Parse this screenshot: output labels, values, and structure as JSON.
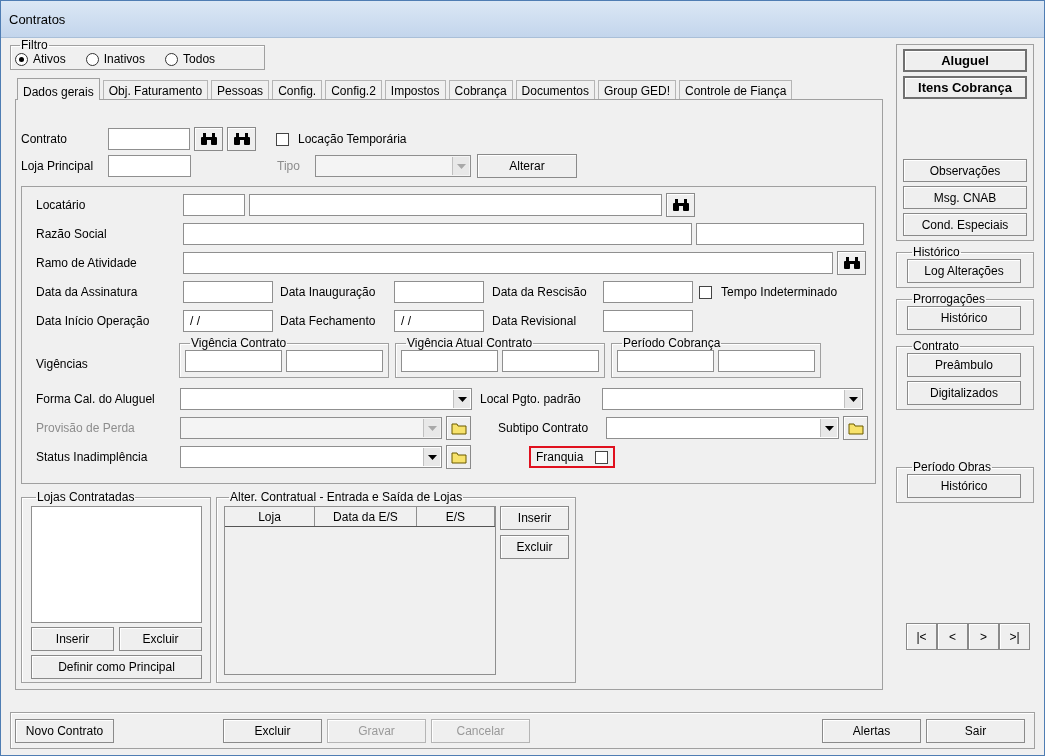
{
  "window": {
    "title": "Contratos"
  },
  "filter": {
    "legend": "Filtro",
    "options": [
      {
        "label": "Ativos",
        "selected": true
      },
      {
        "label": "Inativos",
        "selected": false
      },
      {
        "label": "Todos",
        "selected": false
      }
    ]
  },
  "tabs": [
    {
      "label": "Dados gerais",
      "selected": true
    },
    {
      "label": "Obj. Faturamento",
      "selected": false
    },
    {
      "label": "Pessoas",
      "selected": false
    },
    {
      "label": "Config.",
      "selected": false
    },
    {
      "label": "Config.2",
      "selected": false
    },
    {
      "label": "Impostos",
      "selected": false
    },
    {
      "label": "Cobrança",
      "selected": false
    },
    {
      "label": "Documentos",
      "selected": false
    },
    {
      "label": "Group GED!",
      "selected": false
    },
    {
      "label": "Controle de Fiança",
      "selected": false
    }
  ],
  "header": {
    "contrato_label": "Contrato",
    "locacao_temporaria": {
      "label": "Locação Temporária",
      "checked": false
    },
    "loja_principal_label": "Loja Principal",
    "tipo": {
      "label": "Tipo",
      "disabled": true
    },
    "alterar_button": "Alterar"
  },
  "details": {
    "locatario_label": "Locatário",
    "razao_social_label": "Razão Social",
    "ramo_label": "Ramo de Atividade",
    "data_assinatura_label": "Data da Assinatura",
    "data_inauguracao_label": "Data Inauguração",
    "data_rescisao_label": "Data da Rescisão",
    "tempo_indeterminado": {
      "label": "Tempo Indeterminado",
      "checked": false
    },
    "data_inicio_label": "Data Início Operação",
    "data_inicio_value": "/ /",
    "data_fechamento_label": "Data Fechamento",
    "data_fechamento_value": "/ /",
    "data_revisional_label": "Data Revisional",
    "vigencias_label": "Vigências",
    "vigencia_groups": [
      "Vigência Contrato",
      "Vigência Atual Contrato",
      "Período Cobrança"
    ],
    "forma_calculo_label": "Forma Cal. do Aluguel",
    "local_pgto_label": "Local Pgto. padrão",
    "provisao": {
      "label": "Provisão de Perda",
      "disabled": true
    },
    "subtipo_label": "Subtipo Contrato",
    "status_label": "Status Inadimplência",
    "franquia": {
      "label": "Franquia",
      "checked": false,
      "highlighted": true
    }
  },
  "lojas_contratadas": {
    "legend": "Lojas Contratadas",
    "buttons": [
      "Inserir",
      "Excluir"
    ],
    "principal_button": "Definir como Principal"
  },
  "alter_contratual": {
    "legend": "Alter. Contratual - Entrada e Saída de Lojas",
    "columns": [
      "Loja",
      "Data da E/S",
      "E/S"
    ],
    "buttons": [
      "Inserir",
      "Excluir"
    ]
  },
  "side": {
    "primary_buttons": [
      {
        "label": "Aluguel",
        "bold": true
      },
      {
        "label": "Itens Cobrança",
        "bold": true
      }
    ],
    "secondary_buttons": [
      "Observações",
      "Msg. CNAB",
      "Cond. Especiais"
    ],
    "groups": [
      {
        "legend": "Histórico",
        "buttons": [
          "Log Alterações"
        ]
      },
      {
        "legend": "Prorrogações",
        "buttons": [
          "Histórico"
        ]
      },
      {
        "legend": "Contrato",
        "buttons": [
          "Preâmbulo",
          "Digitalizados"
        ]
      }
    ],
    "periodo_obras": {
      "legend": "Período Obras",
      "buttons": [
        "Histórico"
      ]
    },
    "nav_buttons": [
      "|<",
      "<",
      ">",
      ">|"
    ]
  },
  "footer": {
    "left": [
      {
        "label": "Novo Contrato",
        "disabled": false
      }
    ],
    "center": [
      {
        "label": "Excluir",
        "disabled": false
      },
      {
        "label": "Gravar",
        "disabled": true
      },
      {
        "label": "Cancelar",
        "disabled": true
      }
    ],
    "right": [
      {
        "label": "Alertas",
        "disabled": false
      },
      {
        "label": "Sair",
        "disabled": false
      }
    ]
  }
}
